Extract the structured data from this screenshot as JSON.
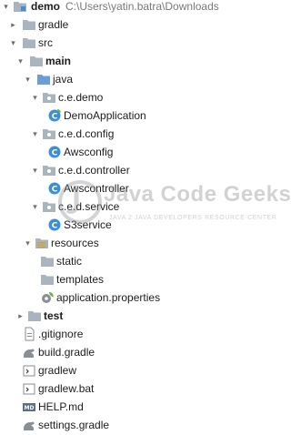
{
  "project": {
    "root_label": "demo",
    "root_path": "C:\\Users\\yatin.batra\\Downloads",
    "gradle": "gradle",
    "src": "src",
    "main": "main",
    "java": "java",
    "pkg_demo": "c.e.demo",
    "demo_application": "DemoApplication",
    "pkg_config": "c.e.d.config",
    "awsconfig": "Awsconfig",
    "pkg_controller": "c.e.d.controller",
    "awscontroller": "Awscontroller",
    "pkg_service": "c.e.d.service",
    "s3service": "S3service",
    "resources": "resources",
    "static": "static",
    "templates": "templates",
    "app_properties": "application.properties",
    "test": "test",
    "gitignore": ".gitignore",
    "build_gradle": "build.gradle",
    "gradlew": "gradlew",
    "gradlew_bat": "gradlew.bat",
    "help": "HELP.md",
    "settings_gradle": "settings.gradle"
  },
  "watermark": {
    "title": "Java Code Geeks",
    "subtitle": "JAVA 2 JAVA DEVELOPERS RESOURCE CENTER"
  },
  "colors": {
    "folder": "#aab4bf",
    "source_folder": "#6a9fd4",
    "resource_folder": "#c9a43a",
    "class_icon": "#3c8fd6",
    "gradle_icon": "#8a8f96",
    "selection": "#dfe4ea",
    "spring_leaf": "#6db33f"
  }
}
